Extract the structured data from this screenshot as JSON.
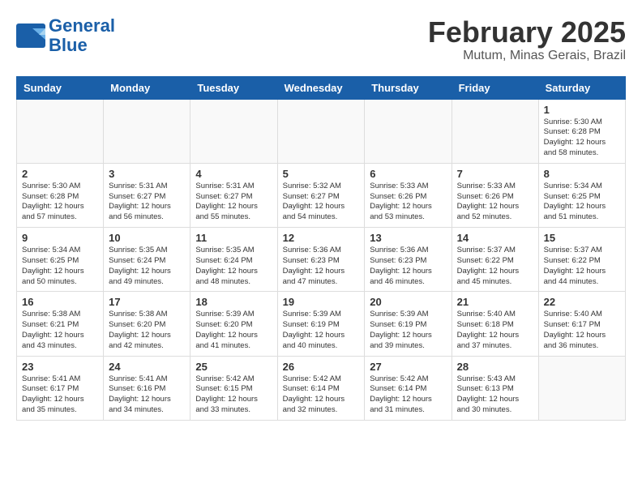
{
  "header": {
    "logo_line1": "General",
    "logo_line2": "Blue",
    "title": "February 2025",
    "subtitle": "Mutum, Minas Gerais, Brazil"
  },
  "weekdays": [
    "Sunday",
    "Monday",
    "Tuesday",
    "Wednesday",
    "Thursday",
    "Friday",
    "Saturday"
  ],
  "weeks": [
    [
      {
        "day": "",
        "info": ""
      },
      {
        "day": "",
        "info": ""
      },
      {
        "day": "",
        "info": ""
      },
      {
        "day": "",
        "info": ""
      },
      {
        "day": "",
        "info": ""
      },
      {
        "day": "",
        "info": ""
      },
      {
        "day": "1",
        "info": "Sunrise: 5:30 AM\nSunset: 6:28 PM\nDaylight: 12 hours\nand 58 minutes."
      }
    ],
    [
      {
        "day": "2",
        "info": "Sunrise: 5:30 AM\nSunset: 6:28 PM\nDaylight: 12 hours\nand 57 minutes."
      },
      {
        "day": "3",
        "info": "Sunrise: 5:31 AM\nSunset: 6:27 PM\nDaylight: 12 hours\nand 56 minutes."
      },
      {
        "day": "4",
        "info": "Sunrise: 5:31 AM\nSunset: 6:27 PM\nDaylight: 12 hours\nand 55 minutes."
      },
      {
        "day": "5",
        "info": "Sunrise: 5:32 AM\nSunset: 6:27 PM\nDaylight: 12 hours\nand 54 minutes."
      },
      {
        "day": "6",
        "info": "Sunrise: 5:33 AM\nSunset: 6:26 PM\nDaylight: 12 hours\nand 53 minutes."
      },
      {
        "day": "7",
        "info": "Sunrise: 5:33 AM\nSunset: 6:26 PM\nDaylight: 12 hours\nand 52 minutes."
      },
      {
        "day": "8",
        "info": "Sunrise: 5:34 AM\nSunset: 6:25 PM\nDaylight: 12 hours\nand 51 minutes."
      }
    ],
    [
      {
        "day": "9",
        "info": "Sunrise: 5:34 AM\nSunset: 6:25 PM\nDaylight: 12 hours\nand 50 minutes."
      },
      {
        "day": "10",
        "info": "Sunrise: 5:35 AM\nSunset: 6:24 PM\nDaylight: 12 hours\nand 49 minutes."
      },
      {
        "day": "11",
        "info": "Sunrise: 5:35 AM\nSunset: 6:24 PM\nDaylight: 12 hours\nand 48 minutes."
      },
      {
        "day": "12",
        "info": "Sunrise: 5:36 AM\nSunset: 6:23 PM\nDaylight: 12 hours\nand 47 minutes."
      },
      {
        "day": "13",
        "info": "Sunrise: 5:36 AM\nSunset: 6:23 PM\nDaylight: 12 hours\nand 46 minutes."
      },
      {
        "day": "14",
        "info": "Sunrise: 5:37 AM\nSunset: 6:22 PM\nDaylight: 12 hours\nand 45 minutes."
      },
      {
        "day": "15",
        "info": "Sunrise: 5:37 AM\nSunset: 6:22 PM\nDaylight: 12 hours\nand 44 minutes."
      }
    ],
    [
      {
        "day": "16",
        "info": "Sunrise: 5:38 AM\nSunset: 6:21 PM\nDaylight: 12 hours\nand 43 minutes."
      },
      {
        "day": "17",
        "info": "Sunrise: 5:38 AM\nSunset: 6:20 PM\nDaylight: 12 hours\nand 42 minutes."
      },
      {
        "day": "18",
        "info": "Sunrise: 5:39 AM\nSunset: 6:20 PM\nDaylight: 12 hours\nand 41 minutes."
      },
      {
        "day": "19",
        "info": "Sunrise: 5:39 AM\nSunset: 6:19 PM\nDaylight: 12 hours\nand 40 minutes."
      },
      {
        "day": "20",
        "info": "Sunrise: 5:39 AM\nSunset: 6:19 PM\nDaylight: 12 hours\nand 39 minutes."
      },
      {
        "day": "21",
        "info": "Sunrise: 5:40 AM\nSunset: 6:18 PM\nDaylight: 12 hours\nand 37 minutes."
      },
      {
        "day": "22",
        "info": "Sunrise: 5:40 AM\nSunset: 6:17 PM\nDaylight: 12 hours\nand 36 minutes."
      }
    ],
    [
      {
        "day": "23",
        "info": "Sunrise: 5:41 AM\nSunset: 6:17 PM\nDaylight: 12 hours\nand 35 minutes."
      },
      {
        "day": "24",
        "info": "Sunrise: 5:41 AM\nSunset: 6:16 PM\nDaylight: 12 hours\nand 34 minutes."
      },
      {
        "day": "25",
        "info": "Sunrise: 5:42 AM\nSunset: 6:15 PM\nDaylight: 12 hours\nand 33 minutes."
      },
      {
        "day": "26",
        "info": "Sunrise: 5:42 AM\nSunset: 6:14 PM\nDaylight: 12 hours\nand 32 minutes."
      },
      {
        "day": "27",
        "info": "Sunrise: 5:42 AM\nSunset: 6:14 PM\nDaylight: 12 hours\nand 31 minutes."
      },
      {
        "day": "28",
        "info": "Sunrise: 5:43 AM\nSunset: 6:13 PM\nDaylight: 12 hours\nand 30 minutes."
      },
      {
        "day": "",
        "info": ""
      }
    ]
  ]
}
